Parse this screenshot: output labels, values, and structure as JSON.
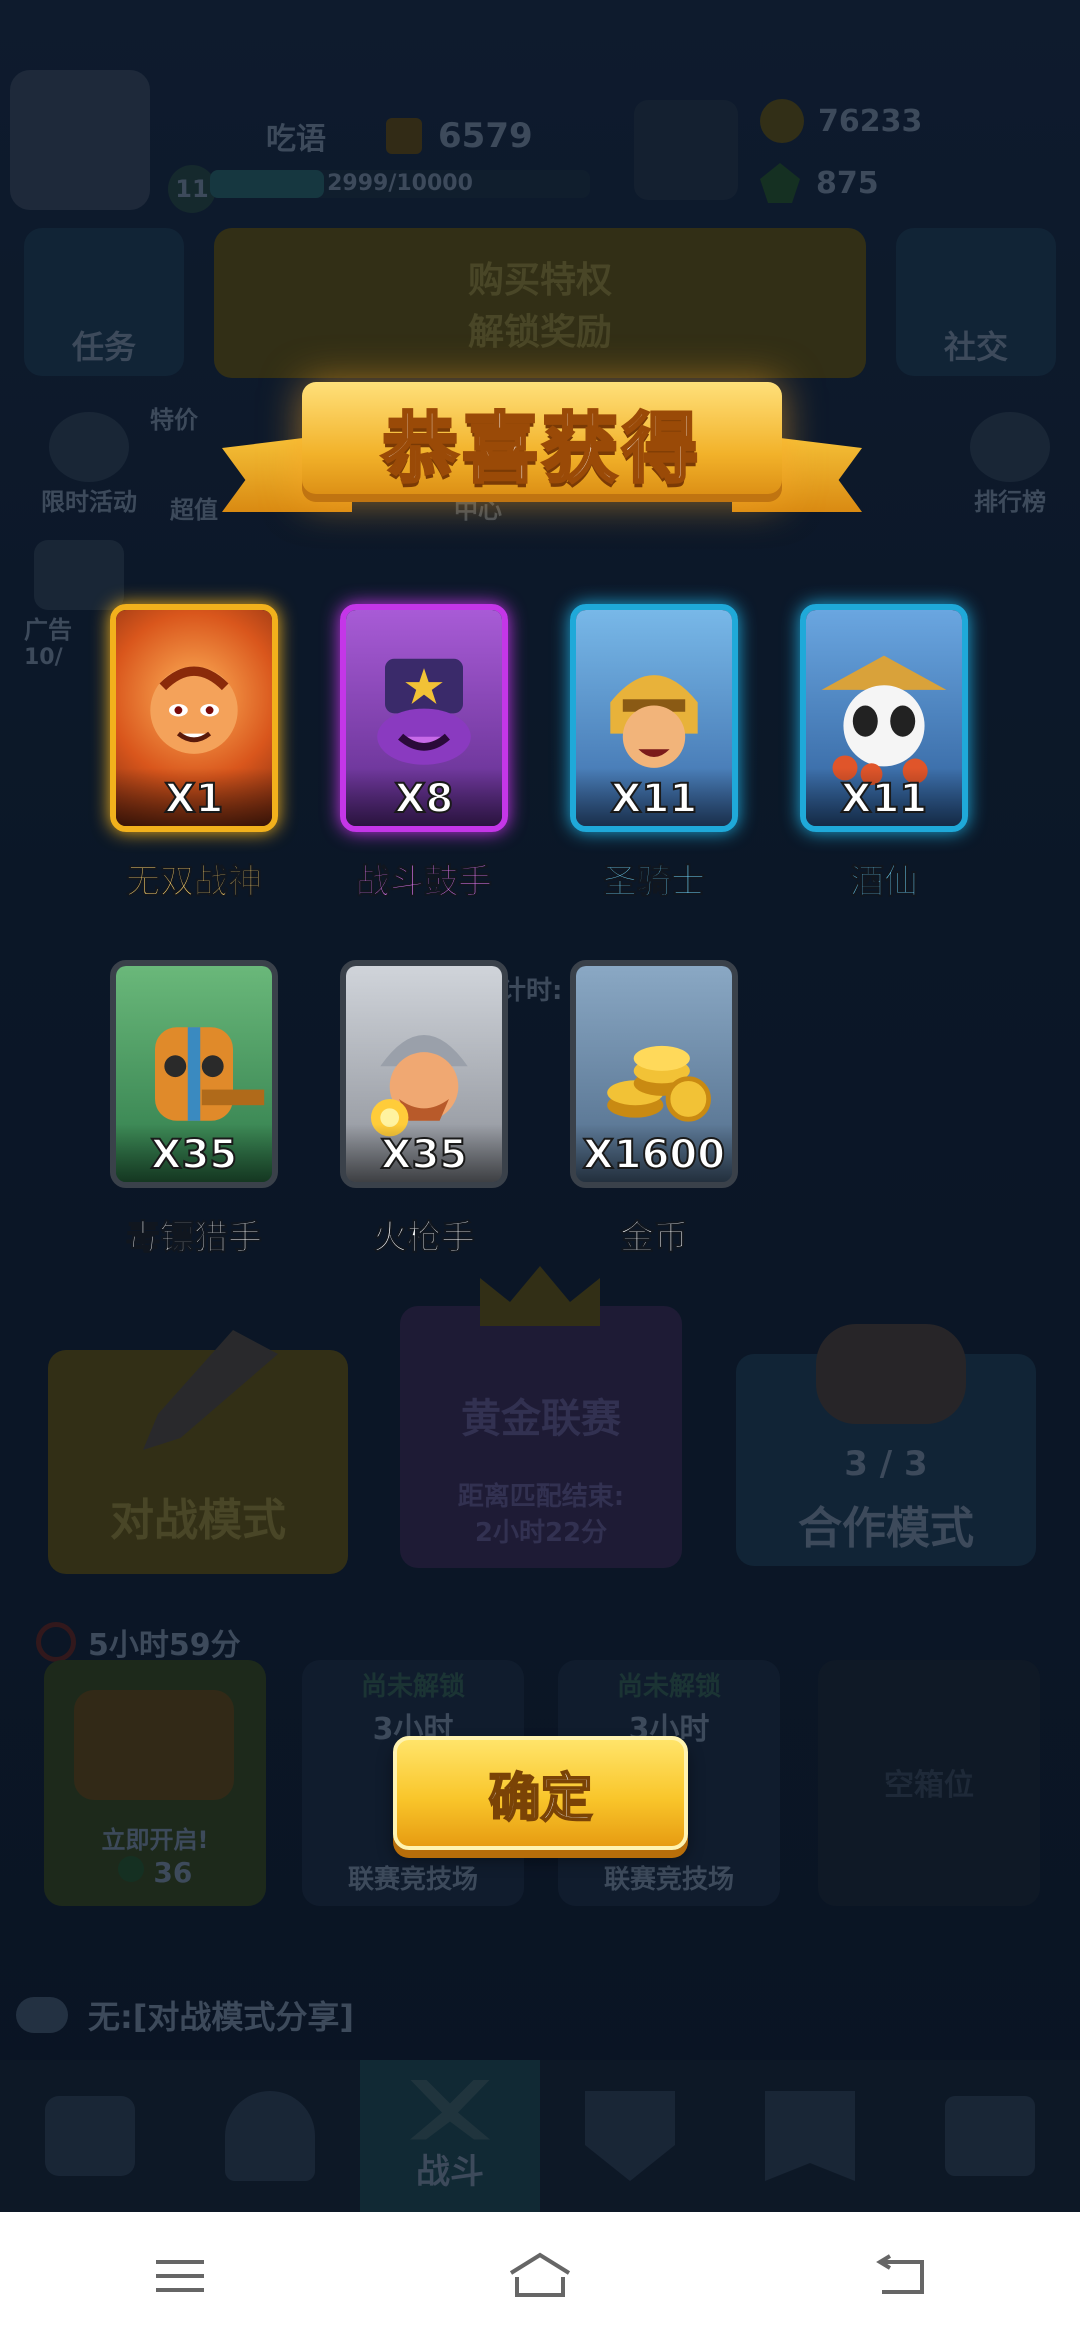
{
  "header": {
    "player_name": "吃语",
    "trophies": "6579",
    "level": "11",
    "xp": "2999/10000",
    "xp_fraction": 0.2999,
    "coins": "76233",
    "gems": "875"
  },
  "lobby": {
    "tasks_label": "任务",
    "buy_privilege": "购买特权",
    "unlock_rewards": "解锁奖励",
    "social_label": "社交",
    "limited_event": "限时活动",
    "super_label": "超值",
    "special_price_label": "特价",
    "center_label": "中心",
    "rank_label": "排行榜",
    "ad_label": "广告",
    "ad_count": "10/",
    "countdown_label": "计时:",
    "battle_mode": "对战模式",
    "gold_league": "黄金联赛",
    "league_match_end": "距离匹配结束:",
    "league_time": "2小时22分",
    "coop_count": "3 / 3",
    "coop_mode": "合作模式",
    "chest_timer": "5小时59分",
    "open_now": "立即开启!",
    "open_cost": "36",
    "locked_1": "尚未解锁",
    "locked_1_time": "3小时",
    "locked_1_name": "联赛竞技场",
    "locked_2": "尚未解锁",
    "locked_2_time": "3小时",
    "locked_2_name": "联赛竞技场",
    "empty_slot": "空箱位",
    "chat_text": "无:[对战模式分享]",
    "bottom_nav_battle": "战斗"
  },
  "reward_dialog": {
    "title": "恭喜获得",
    "items": [
      {
        "name": "无双战神",
        "qty": "X1",
        "rarity_color": "#ffd36b",
        "frame_color": "#f2b11c"
      },
      {
        "name": "战斗鼓手",
        "qty": "X8",
        "rarity_color": "#f07cff",
        "frame_color": "#c436e8"
      },
      {
        "name": "圣骑士",
        "qty": "X11",
        "rarity_color": "#6fd8ff",
        "frame_color": "#1fa9d9"
      },
      {
        "name": "酒仙",
        "qty": "X11",
        "rarity_color": "#6fd8ff",
        "frame_color": "#1fa9d9"
      },
      {
        "name": "毒镖猎手",
        "qty": "X35",
        "rarity_color": "#ffffff",
        "frame_color": "#3a414a"
      },
      {
        "name": "火枪手",
        "qty": "X35",
        "rarity_color": "#ffffff",
        "frame_color": "#3a414a"
      },
      {
        "name": "金币",
        "qty": "X1600",
        "rarity_color": "#ffffff",
        "frame_color": "#3a414a"
      }
    ],
    "confirm_label": "确定"
  },
  "system_nav": {
    "icons": [
      "menu-icon",
      "home-icon",
      "back-icon"
    ]
  }
}
